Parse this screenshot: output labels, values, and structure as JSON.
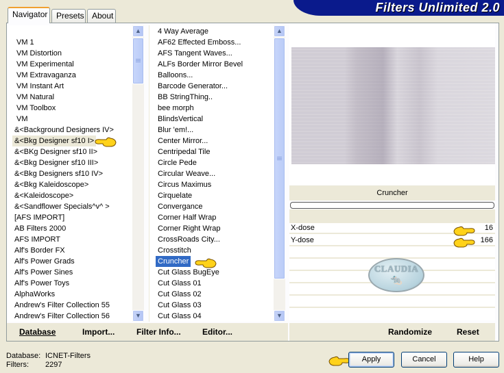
{
  "window": {
    "title": "Filters Unlimited 2.0"
  },
  "tabs": [
    {
      "label": "Navigator",
      "active": true
    },
    {
      "label": "Presets",
      "active": false
    },
    {
      "label": "About",
      "active": false
    }
  ],
  "categories": {
    "items": [
      "VM 1",
      "VM Distortion",
      "VM Experimental",
      "VM Extravaganza",
      "VM Instant Art",
      "VM Natural",
      "VM Toolbox",
      "VM",
      "&<Background Designers IV>",
      "&<Bkg Designer sf10 I>",
      "&<BKg Designer sf10 II>",
      "&<Bkg Designer sf10 III>",
      "&<Bkg Designers sf10 IV>",
      "&<Bkg Kaleidoscope>",
      "&<Kaleidoscope>",
      "&<Sandflower Specials^v^ >",
      "[AFS IMPORT]",
      "AB Filters 2000",
      "AFS IMPORT",
      "Alf's Border FX",
      "Alf's Power Grads",
      "Alf's Power Sines",
      "Alf's Power Toys",
      "AlphaWorks",
      "Andrew's Filter Collection 55",
      "Andrew's Filter Collection 56"
    ],
    "selected": "&<Bkg Designer sf10 I>"
  },
  "filters": {
    "items": [
      "4 Way Average",
      "AF62 Effected Emboss...",
      "AFS Tangent Waves...",
      "ALFs Border Mirror Bevel",
      "Balloons...",
      "Barcode Generator...",
      "BB StringThing..",
      "bee morph",
      "BlindsVertical",
      "Blur 'em!...",
      "Center Mirror...",
      "Centripedal Tile",
      "Circle Pede",
      "Circular Weave...",
      "Circus Maximus",
      "Cirquelate",
      "Convergance",
      "Corner Half Wrap",
      "Corner Right Wrap",
      "CrossRoads City...",
      "Crosstitch",
      "Cruncher",
      "Cut Glass  BugEye",
      "Cut Glass 01",
      "Cut Glass 02",
      "Cut Glass 03",
      "Cut Glass 04"
    ],
    "selected": "Cruncher"
  },
  "commands": {
    "database": "Database",
    "import": "Import...",
    "filter_info": "Filter Info...",
    "editor": "Editor..."
  },
  "effect": {
    "name": "Cruncher",
    "progress": 0,
    "params": [
      {
        "label": "X-dose",
        "value": "16"
      },
      {
        "label": "Y-dose",
        "value": "166"
      }
    ],
    "randomize": "Randomize",
    "reset": "Reset"
  },
  "watermark": {
    "text": "CLAUDIA"
  },
  "footer": {
    "database_label": "Database:",
    "database_value": "ICNET-Filters",
    "filters_label": "Filters:",
    "filters_value": "2297"
  },
  "buttons": {
    "apply": "Apply",
    "cancel": "Cancel",
    "help": "Help"
  }
}
